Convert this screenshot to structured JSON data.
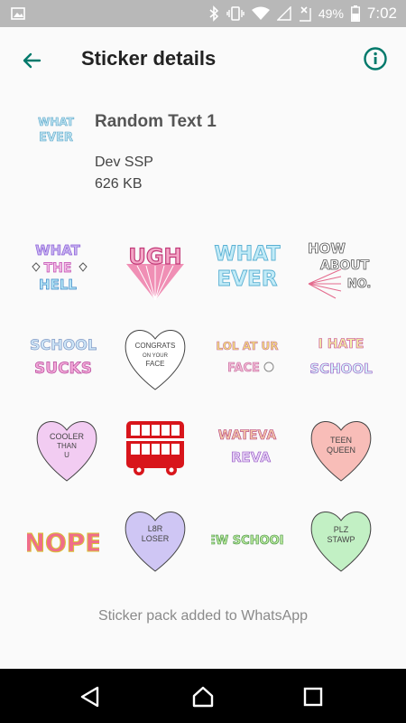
{
  "status_bar": {
    "battery": "49%",
    "time": "7:02",
    "icons": [
      "image-icon",
      "bluetooth-icon",
      "vibrate-icon",
      "wifi-icon",
      "signal-icon",
      "no-sim-icon",
      "battery-icon"
    ]
  },
  "toolbar": {
    "title": "Sticker details",
    "back_icon": "arrow-back-icon",
    "info_icon": "info-icon"
  },
  "pack": {
    "tray_text_1": "WHAT",
    "tray_text_2": "EVER",
    "name": "Random Text 1",
    "author": "Dev SSP",
    "size": "626 KB"
  },
  "stickers": [
    {
      "lines": [
        "WHAT",
        "THE",
        "HELL"
      ]
    },
    {
      "lines": [
        "UGH"
      ]
    },
    {
      "lines": [
        "WHAT",
        "EVER"
      ]
    },
    {
      "lines": [
        "HOW",
        "ABOUT",
        "NO."
      ]
    },
    {
      "lines": [
        "SCHOOL",
        "SUCKS"
      ]
    },
    {
      "lines": [
        "CONGRATS",
        "ON YOUR",
        "FACE"
      ]
    },
    {
      "lines": [
        "LOL AT UR",
        "FACE"
      ]
    },
    {
      "lines": [
        "I HATE",
        "SCHOOL"
      ]
    },
    {
      "lines": [
        "COOLER",
        "THAN",
        "U"
      ]
    },
    {
      "lines": []
    },
    {
      "lines": [
        "WATEVA",
        "REVA"
      ]
    },
    {
      "lines": [
        "TEEN",
        "QUEEN"
      ]
    },
    {
      "lines": [
        "NOPE"
      ]
    },
    {
      "lines": [
        "L8R",
        "LOSER"
      ]
    },
    {
      "lines": [
        "EW SCHOOL"
      ]
    },
    {
      "lines": [
        "PLZ",
        "STAWP"
      ]
    }
  ],
  "footer": {
    "status_text": "Sticker pack added to WhatsApp"
  },
  "nav": {
    "back": "nav-back-icon",
    "home": "nav-home-icon",
    "recents": "nav-recents-icon"
  },
  "colors": {
    "accent": "#00796b",
    "status_bar": "#b8b8b8",
    "nav_bar": "#000000"
  }
}
